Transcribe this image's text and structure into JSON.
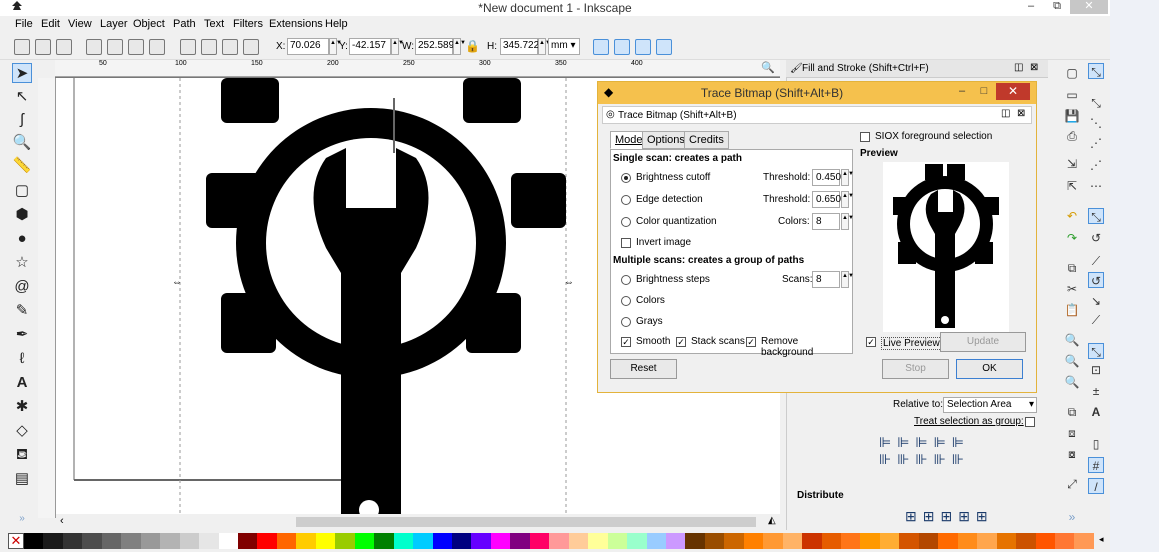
{
  "window": {
    "title": "*New document 1 - Inkscape",
    "minimize": "–",
    "maximize": "⧉",
    "close": "✕"
  },
  "menu": [
    "File",
    "Edit",
    "View",
    "Layer",
    "Object",
    "Path",
    "Text",
    "Filters",
    "Extensions",
    "Help"
  ],
  "toolbar": {
    "x_label": "X:",
    "x_value": "70.026",
    "y_label": "Y:",
    "y_value": "-42.157",
    "w_label": "W:",
    "w_value": "252.589",
    "h_label": "H:",
    "h_value": "345.722",
    "unit": "mm"
  },
  "ruler": {
    "ticks": [
      "50",
      "100",
      "150",
      "200",
      "250",
      "300",
      "350",
      "400"
    ]
  },
  "dock": {
    "title": "Fill and Stroke (Shift+Ctrl+F)",
    "relative_to_label": "Relative to:",
    "relative_to_value": "Selection Area",
    "treat_group_label": "Treat selection as group:",
    "distribute_label": "Distribute"
  },
  "dialog": {
    "title": "Trace Bitmap (Shift+Alt+B)",
    "subtitle": "Trace Bitmap (Shift+Alt+B)",
    "tabs": [
      "Mode",
      "Options",
      "Credits"
    ],
    "single_scan_heading": "Single scan: creates a path",
    "brightness_cutoff": "Brightness cutoff",
    "edge_detection": "Edge detection",
    "color_quantization": "Color quantization",
    "invert_image": "Invert image",
    "threshold_label": "Threshold:",
    "threshold_1": "0.450",
    "threshold_2": "0.650",
    "colors_label": "Colors:",
    "colors_value": "8",
    "multiple_scans_heading": "Multiple scans: creates a group of paths",
    "brightness_steps": "Brightness steps",
    "colors_opt": "Colors",
    "grays_opt": "Grays",
    "scans_label": "Scans:",
    "scans_value": "8",
    "smooth": "Smooth",
    "stack_scans": "Stack scans",
    "remove_background": "Remove background",
    "siox_label": "SIOX foreground selection",
    "preview_heading": "Preview",
    "live_preview": "Live Preview",
    "update_button": "Update",
    "reset_button": "Reset",
    "stop_button": "Stop",
    "ok_button": "OK"
  },
  "colors": {
    "dialog_title_bg": "#f5c14d",
    "close_red": "#c0392b",
    "selection_blue": "#cfe4fa"
  },
  "palette": [
    "#000000",
    "#1a1a1a",
    "#333333",
    "#4d4d4d",
    "#666666",
    "#808080",
    "#999999",
    "#b3b3b3",
    "#cccccc",
    "#e6e6e6",
    "#ffffff",
    "#800000",
    "#ff0000",
    "#ff6600",
    "#ffcc00",
    "#ffff00",
    "#99cc00",
    "#00ff00",
    "#008000",
    "#00ffcc",
    "#00ccff",
    "#0000ff",
    "#000080",
    "#6600ff",
    "#ff00ff",
    "#800080",
    "#ff0066",
    "#ff9999",
    "#ffcc99",
    "#ffff99",
    "#ccff99",
    "#99ffcc",
    "#99ccff",
    "#cc99ff",
    "#663300",
    "#994d00",
    "#cc6600",
    "#ff8000",
    "#ff9933",
    "#ffb366",
    "#cc3300",
    "#e65c00",
    "#ff7518",
    "#ff9900",
    "#ffad33",
    "#d45500",
    "#b34700",
    "#ff6a00",
    "#ff8c1a",
    "#ffa64d",
    "#e67300",
    "#cc5200",
    "#ff5500",
    "#ff7733",
    "#ff9955"
  ]
}
